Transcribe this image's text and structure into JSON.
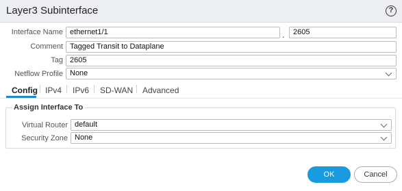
{
  "window": {
    "title": "Layer3 Subinterface",
    "help_icon": "?"
  },
  "form": {
    "interface_name": {
      "label": "Interface Name",
      "value": "ethernet1/1",
      "separator": ".",
      "subinterface": "2605"
    },
    "comment": {
      "label": "Comment",
      "value": "Tagged Transit to Dataplane"
    },
    "tag": {
      "label": "Tag",
      "value": "2605"
    },
    "netflow_profile": {
      "label": "Netflow Profile",
      "value": "None"
    }
  },
  "tabs": [
    "Config",
    "IPv4",
    "IPv6",
    "SD-WAN",
    "Advanced"
  ],
  "assign": {
    "legend": "Assign Interface To",
    "virtual_router": {
      "label": "Virtual Router",
      "value": "default"
    },
    "security_zone": {
      "label": "Security Zone",
      "value": "None"
    }
  },
  "buttons": {
    "ok": "OK",
    "cancel": "Cancel"
  },
  "colors": {
    "accent": "#1a9be0",
    "tab_underline": "#1a8bd0",
    "titlebar_bg": "#eceef1"
  }
}
